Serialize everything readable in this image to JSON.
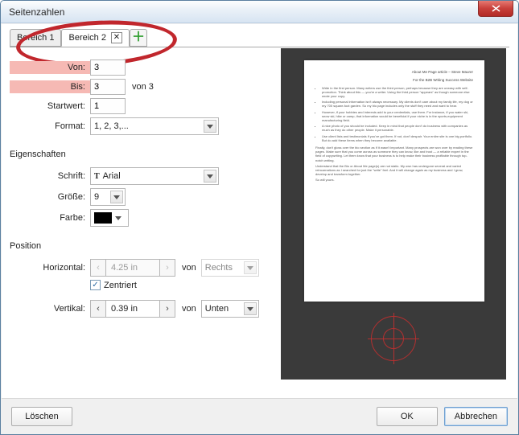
{
  "window": {
    "title": "Seitenzahlen"
  },
  "tabs": {
    "items": [
      {
        "label": "Bereich 1"
      },
      {
        "label": "Bereich 2"
      }
    ]
  },
  "range": {
    "from_label": "Von:",
    "from_value": "3",
    "to_label": "Bis:",
    "to_value": "3",
    "total": "von 3",
    "start_label": "Startwert:",
    "start_value": "1",
    "format_label": "Format:",
    "format_value": "1, 2, 3,..."
  },
  "properties": {
    "heading": "Eigenschaften",
    "font_label": "Schrift:",
    "font_value": "Arial",
    "size_label": "Größe:",
    "size_value": "9",
    "color_label": "Farbe:",
    "color_value": "#000000"
  },
  "position": {
    "heading": "Position",
    "h_label": "Horizontal:",
    "h_value": "4.25 in",
    "h_anchor": "Rechts",
    "of_label": "von",
    "centered_label": "Zentriert",
    "centered_checked": true,
    "v_label": "Vertikal:",
    "v_value": "0.39 in",
    "v_anchor": "Unten"
  },
  "preview": {
    "head1": "About Me Page article – Steve Maurer",
    "head2": "For the B2B Writing Success Website",
    "bullets": [
      "Write in the first person. Many writers use the third person, perhaps because they are uneasy with self-promotion. Think about this — you're a writer. Using the third person \"appears\" as though someone else wrote your copy.",
      "Including personal information isn't always necessary. My clients don't care about my family life, my dog or my 700 square-foot garden. So my bio page includes only the stuff they need and want to hear.",
      "However, if your hobbies and interests add to your credentials, use them. For instance, if you water ski, snow ski, hike or camp, that information would be beneficial if your niche is in the sports-equipment manufacturing field.",
      "A nice photo of you should be included. Keep in mind that people don't do business with companies as much as they do other people. Make it personable.",
      "Use client lists and testimonials if you've got them. If not, don't despair. Your entire site is one big portfolio. But do add these items when they become available."
    ],
    "para1": "Finally, don't gloss over the bio section as if it wasn't important. Many prospects are won over by reading these pages. Make sure that you come across as someone they can know, like and trust — a reliable expert in the field of copywriting. Let them know that your business is to help make their business profitable through top-notch writing.",
    "para2": "Understand that the Bio or About Me page(s) are not static. My own has undergone several and varied reincarnations as I searched for just the \"write\" feel. And it will change again as my business and I grow, develop and transform together.",
    "para3": "So will yours."
  },
  "footer": {
    "delete": "Löschen",
    "ok": "OK",
    "cancel": "Abbrechen"
  }
}
